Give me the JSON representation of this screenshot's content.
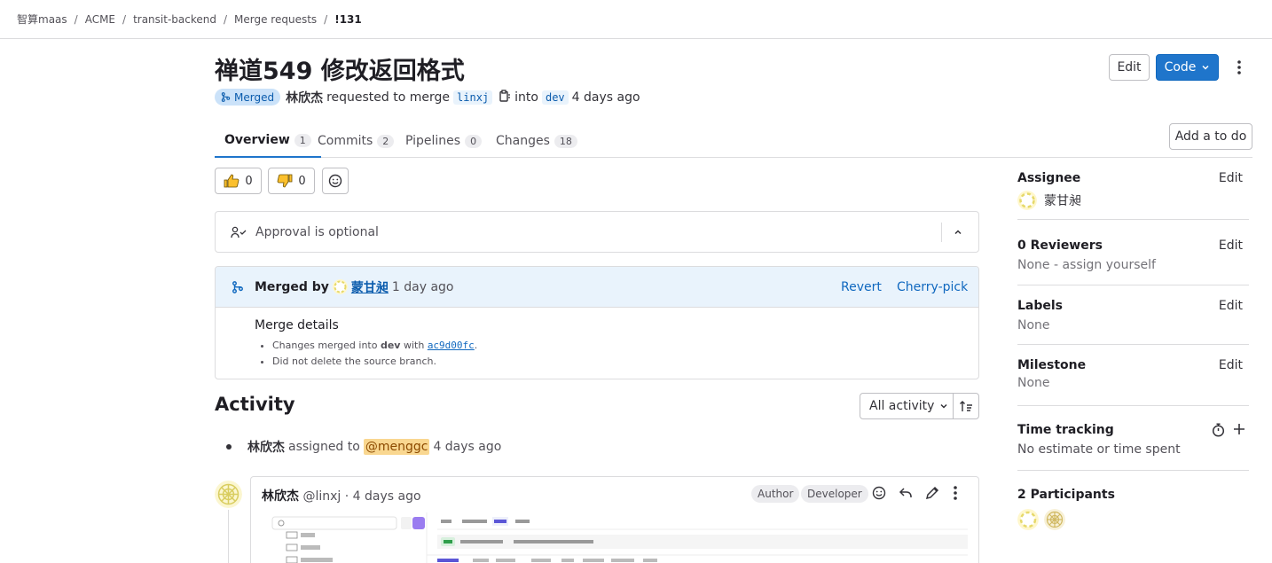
{
  "breadcrumb": [
    "智算maas",
    "ACME",
    "transit-backend",
    "Merge requests",
    "!131"
  ],
  "mr": {
    "title": "禅道549 修改返回格式",
    "status": "Merged",
    "author": "林欣杰",
    "requested_text": "requested to merge",
    "source_branch": "linxj",
    "into_text": "into",
    "target_branch": "dev",
    "time": "4 days ago"
  },
  "header_buttons": {
    "edit": "Edit",
    "code": "Code"
  },
  "tabs": [
    {
      "label": "Overview",
      "count": "1"
    },
    {
      "label": "Commits",
      "count": "2"
    },
    {
      "label": "Pipelines",
      "count": "0"
    },
    {
      "label": "Changes",
      "count": "18"
    }
  ],
  "add_todo": "Add a to do",
  "reactions": {
    "thumbsup": "0",
    "thumbsdown": "0"
  },
  "approval": {
    "text": "Approval is optional"
  },
  "merge": {
    "merged_by_label": "Merged by",
    "user": "蒙甘昶",
    "time": "1 day ago",
    "revert": "Revert",
    "cherry_pick": "Cherry-pick",
    "details_title": "Merge details",
    "line1_prefix": "Changes merged into ",
    "line1_branch": "dev",
    "line1_mid": " with ",
    "line1_sha": "ac9d00fc",
    "line1_suffix": ".",
    "line2": "Did not delete the source branch."
  },
  "activity": {
    "title": "Activity",
    "filter": "All activity",
    "system_note": {
      "author": "林欣杰",
      "action": "assigned to",
      "mention": "@menggc",
      "time": "4 days ago"
    },
    "comment": {
      "author": "林欣杰",
      "handle": "@linxj · 4 days ago",
      "role1": "Author",
      "role2": "Developer"
    }
  },
  "sidebar": {
    "assignee": {
      "label": "Assignee",
      "edit": "Edit",
      "value": "蒙甘昶"
    },
    "reviewers": {
      "label": "0 Reviewers",
      "edit": "Edit",
      "value": "None - assign yourself"
    },
    "labels": {
      "label": "Labels",
      "edit": "Edit",
      "value": "None"
    },
    "milestone": {
      "label": "Milestone",
      "edit": "Edit",
      "value": "None"
    },
    "time_tracking": {
      "label": "Time tracking",
      "value": "No estimate or time spent"
    },
    "participants": {
      "label": "2 Participants"
    }
  },
  "colors": {
    "primary": "#1f75cb",
    "merged_badge_bg": "#cbe2f9",
    "mention_bg": "#f9d790"
  }
}
